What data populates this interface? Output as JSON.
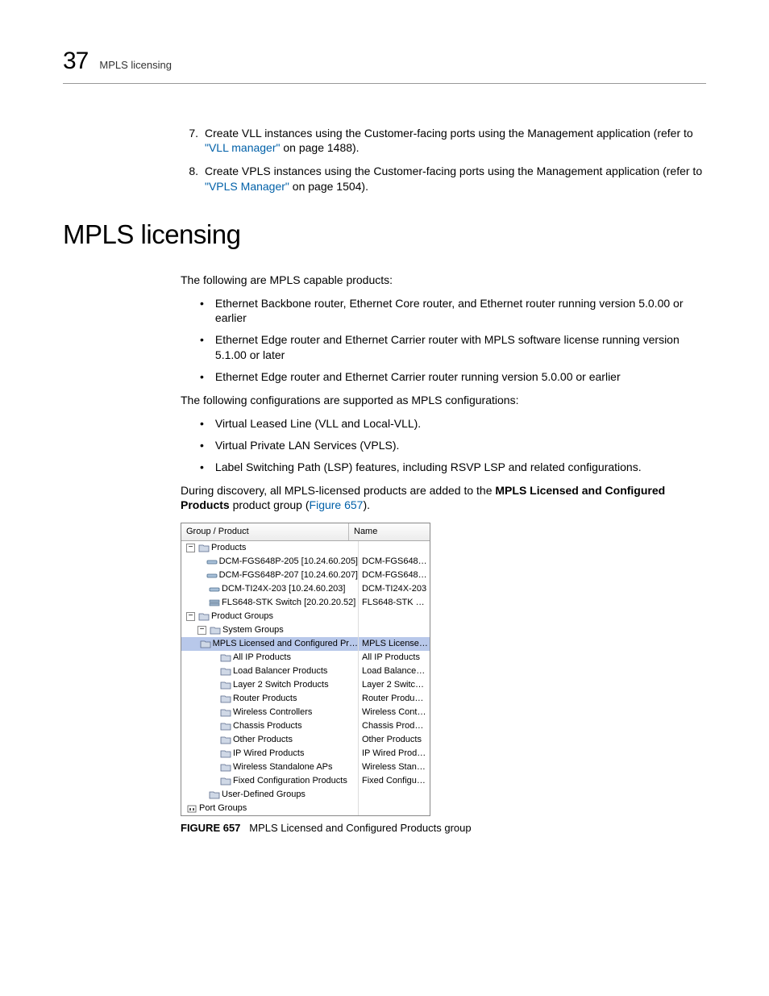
{
  "header": {
    "page_num": "37",
    "title": "MPLS licensing"
  },
  "steps": [
    {
      "num": "7.",
      "pre": "Create VLL instances using the Customer-facing ports using the Management application (refer to ",
      "link": "\"VLL manager\"",
      "post": " on page 1488)."
    },
    {
      "num": "8.",
      "pre": "Create VPLS instances using the Customer-facing ports using the Management application (refer to ",
      "link": "\"VPLS Manager\"",
      "post": " on page 1504)."
    }
  ],
  "section_title": "MPLS licensing",
  "intro1": "The following are MPLS capable products:",
  "bullets1": [
    "Ethernet Backbone router, Ethernet Core router, and Ethernet router  running version 5.0.00 or earlier",
    "Ethernet Edge router and Ethernet Carrier router with MPLS software license running version 5.1.00 or later",
    "Ethernet Edge router and Ethernet Carrier router running version 5.0.00 or earlier"
  ],
  "intro2": "The following configurations are supported as MPLS configurations:",
  "bullets2": [
    "Virtual Leased Line (VLL and Local-VLL).",
    "Virtual Private LAN Services (VPLS).",
    "Label Switching Path (LSP) features, including RSVP LSP and related configurations."
  ],
  "discovery": {
    "pre": "During discovery, all MPLS-licensed products are added to the ",
    "bold": "MPLS Licensed and Configured Products",
    "mid": " product group (",
    "link": "Figure 657",
    "post": ")."
  },
  "tree": {
    "headers": {
      "group": "Group / Product",
      "name": "Name"
    },
    "rows": [
      {
        "depth": 0,
        "exp": "−",
        "icon": "folder",
        "label": "Products",
        "name": ""
      },
      {
        "depth": 1,
        "line": true,
        "icon": "device",
        "label": "DCM-FGS648P-205 [10.24.60.205]",
        "name": "DCM-FGS648…"
      },
      {
        "depth": 1,
        "line": true,
        "icon": "device",
        "label": "DCM-FGS648P-207 [10.24.60.207]",
        "name": "DCM-FGS648…"
      },
      {
        "depth": 1,
        "line": true,
        "icon": "device",
        "label": "DCM-TI24X-203 [10.24.60.203]",
        "name": "DCM-TI24X-203"
      },
      {
        "depth": 1,
        "line": true,
        "icon": "stack",
        "label": "FLS648-STK Switch [20.20.20.52]",
        "name": "FLS648-STK …"
      },
      {
        "depth": 0,
        "exp": "−",
        "icon": "folder",
        "label": "Product Groups",
        "name": ""
      },
      {
        "depth": 1,
        "exp": "−",
        "icon": "folder",
        "label": "System Groups",
        "name": ""
      },
      {
        "depth": 2,
        "line": true,
        "sel": true,
        "icon": "folder",
        "label": "MPLS Licensed and Configured Pr…",
        "name": "MPLS License…"
      },
      {
        "depth": 2,
        "line": true,
        "icon": "folder",
        "label": "All IP Products",
        "name": "All IP Products"
      },
      {
        "depth": 2,
        "line": true,
        "icon": "folder",
        "label": "Load Balancer Products",
        "name": "Load Balance…"
      },
      {
        "depth": 2,
        "line": true,
        "icon": "folder",
        "label": "Layer 2 Switch Products",
        "name": "Layer 2 Switc…"
      },
      {
        "depth": 2,
        "line": true,
        "icon": "folder",
        "label": "Router Products",
        "name": "Router Produ…"
      },
      {
        "depth": 2,
        "line": true,
        "icon": "folder",
        "label": "Wireless Controllers",
        "name": "Wireless Cont…"
      },
      {
        "depth": 2,
        "line": true,
        "icon": "folder",
        "label": "Chassis Products",
        "name": "Chassis Prod…"
      },
      {
        "depth": 2,
        "line": true,
        "icon": "folder",
        "label": "Other Products",
        "name": "Other Products"
      },
      {
        "depth": 2,
        "line": true,
        "icon": "folder",
        "label": "IP Wired Products",
        "name": "IP Wired Prod…"
      },
      {
        "depth": 2,
        "line": true,
        "icon": "folder",
        "label": "Wireless Standalone APs",
        "name": "Wireless Stan…"
      },
      {
        "depth": 2,
        "line": true,
        "icon": "folder",
        "label": "Fixed Configuration Products",
        "name": "Fixed Configu…"
      },
      {
        "depth": 1,
        "line": true,
        "icon": "folder",
        "label": "User-Defined Groups",
        "name": ""
      },
      {
        "depth": 0,
        "icon": "port",
        "label": "Port Groups",
        "name": ""
      }
    ]
  },
  "figure": {
    "num": "FIGURE 657",
    "caption": "MPLS Licensed and Configured Products group"
  }
}
